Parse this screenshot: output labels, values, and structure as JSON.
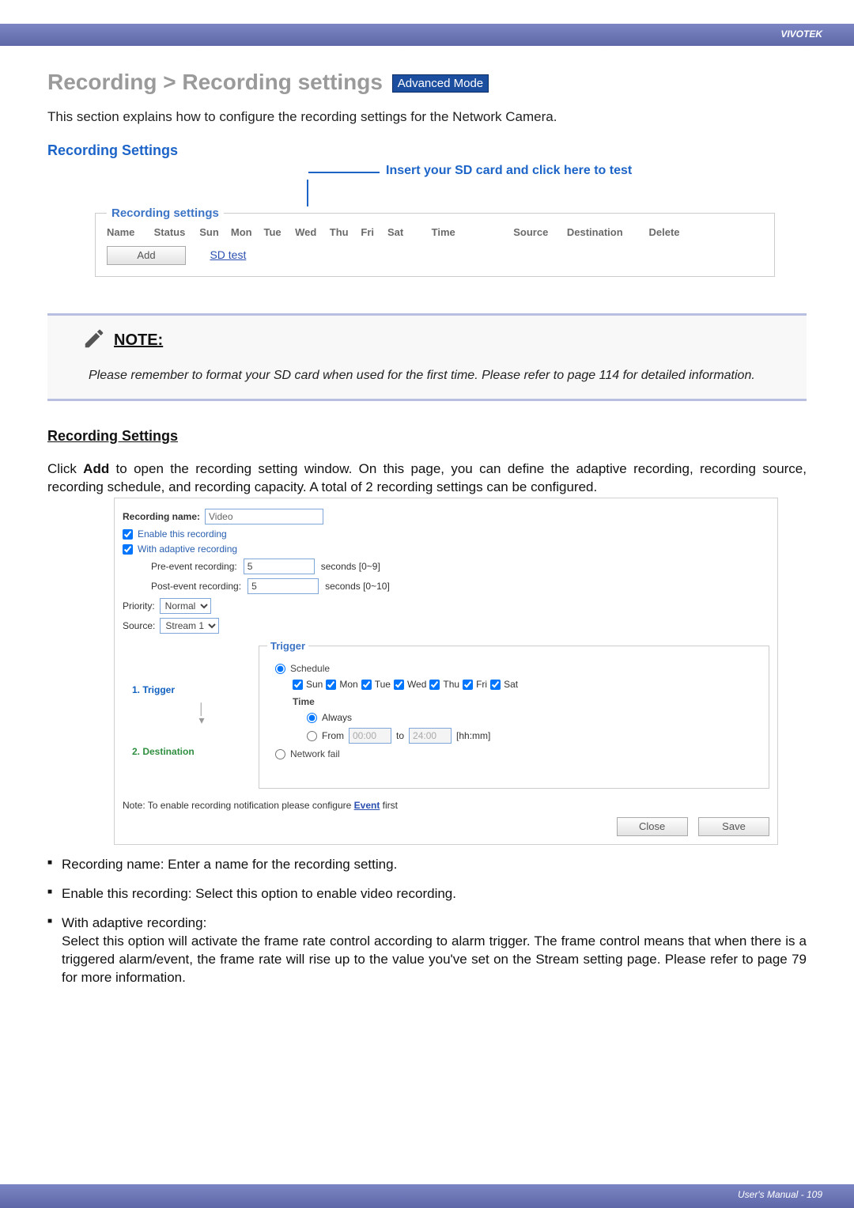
{
  "brand": "VIVOTEK",
  "title_prefix": "Recording > Recording settings",
  "adv_mode": "Advanced Mode",
  "intro": "This section explains how to configure the recording settings for the Network Camera.",
  "section_heading": "Recording Settings",
  "callout": "Insert your SD card and click here to test",
  "rec_fieldset_legend": "Recording settings",
  "rec_cols": {
    "name": "Name",
    "status": "Status",
    "sun": "Sun",
    "mon": "Mon",
    "tue": "Tue",
    "wed": "Wed",
    "thu": "Thu",
    "fri": "Fri",
    "sat": "Sat",
    "time": "Time",
    "source": "Source",
    "dest": "Destination",
    "delete": "Delete"
  },
  "add_btn": "Add",
  "sd_test_link": "SD test",
  "note_title": "NOTE:",
  "note_body": "Please remember to format your SD card when used for the first time. Please refer to page 114 for detailed information.",
  "sub_heading": "Recording Settings",
  "body_p_pre": "Click ",
  "body_p_bold": "Add",
  "body_p_post": " to open the recording setting window. On this page, you can define the adaptive recording, recording source, recording schedule, and recording capacity. A total of 2 recording settings can be configured.",
  "form": {
    "name_label": "Recording name:",
    "name_value": "Video",
    "enable_label": "Enable this recording",
    "adaptive_label": "With adaptive recording",
    "pre_label": "Pre-event recording:",
    "pre_value": "5",
    "pre_hint": "seconds [0~9]",
    "post_label": "Post-event recording:",
    "post_value": "5",
    "post_hint": "seconds [0~10]",
    "priority_label": "Priority:",
    "priority_value": "Normal",
    "source_label": "Source:",
    "source_value": "Stream 1",
    "step1": "1. Trigger",
    "step2": "2. Destination",
    "trigger_legend": "Trigger",
    "schedule_label": "Schedule",
    "days": [
      "Sun",
      "Mon",
      "Tue",
      "Wed",
      "Thu",
      "Fri",
      "Sat"
    ],
    "time_heading": "Time",
    "always_label": "Always",
    "from_label": "From",
    "from_value": "00:00",
    "to_label": "to",
    "to_value": "24:00",
    "hhmm": "[hh:mm]",
    "netfail_label": "Network fail",
    "config_note_pre": "Note: To enable recording notification please configure ",
    "config_note_link": "Event",
    "config_note_post": " first",
    "close_btn": "Close",
    "save_btn": "Save"
  },
  "bullets": {
    "b1": "Recording name: Enter a name for the recording setting.",
    "b2": "Enable this recording: Select this option to enable video recording.",
    "b3_head": "With adaptive recording:",
    "b3_body": "Select this option will activate the frame rate control according to alarm trigger. The frame control means that when there is a triggered alarm/event, the frame rate will rise up to the value you've set on the Stream setting page. Please refer to page 79 for more information."
  },
  "footer": "User's Manual - 109"
}
